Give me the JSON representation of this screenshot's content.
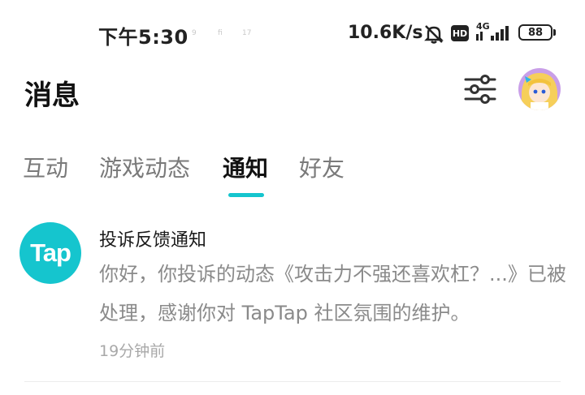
{
  "status_bar": {
    "time": "下午5:30",
    "mini_icons": [
      "9",
      "fi",
      "17"
    ],
    "net_speed": "10.6K/s",
    "mute_icon": "bell-off-icon",
    "hd_badge": "HD",
    "network": "4G",
    "battery": "88"
  },
  "header": {
    "title": "消息",
    "filter_icon": "sliders-icon"
  },
  "tabs": [
    {
      "label": "互动",
      "active": false
    },
    {
      "label": "游戏动态",
      "active": false
    },
    {
      "label": "通知",
      "active": true
    },
    {
      "label": "好友",
      "active": false
    }
  ],
  "notification": {
    "app_logo_text": "Tap",
    "title": "投诉反馈通知",
    "body": "你好，你投诉的动态《攻击力不强还喜欢杠？...》已被处理，感谢你对 TapTap 社区氛围的维护。",
    "time": "19分钟前"
  },
  "colors": {
    "accent": "#15c5ce",
    "text_primary": "#1a1a1a",
    "text_secondary": "#8a8a8a"
  }
}
